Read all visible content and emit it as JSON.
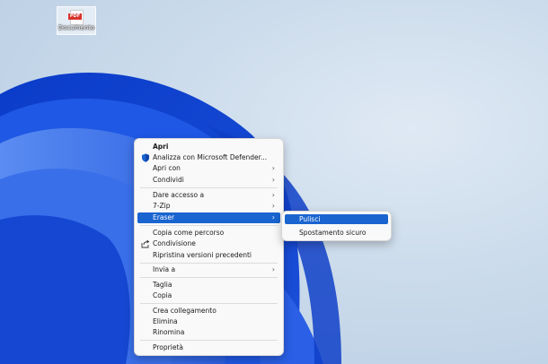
{
  "desktop": {
    "icon": {
      "badge": "PDF",
      "label": "Documento",
      "icon_name": "pdf-file-icon"
    }
  },
  "context_menu": {
    "items": [
      {
        "label": "Apri",
        "bold": true,
        "has_submenu": false,
        "icon": null
      },
      {
        "label": "Analizza con Microsoft Defender...",
        "has_submenu": false,
        "icon": "defender-shield-icon"
      },
      {
        "label": "Apri con",
        "has_submenu": true,
        "icon": null
      },
      {
        "label": "Condividi",
        "has_submenu": true,
        "icon": null
      },
      {
        "label": "Dare accesso a",
        "has_submenu": true,
        "icon": null
      },
      {
        "label": "7-Zip",
        "has_submenu": true,
        "icon": null
      },
      {
        "label": "Eraser",
        "has_submenu": true,
        "icon": null,
        "highlighted": true
      },
      {
        "label": "Copia come percorso",
        "has_submenu": false,
        "icon": null
      },
      {
        "label": "Condivisione",
        "has_submenu": false,
        "icon": "share-icon"
      },
      {
        "label": "Ripristina versioni precedenti",
        "has_submenu": false,
        "icon": null
      },
      {
        "label": "Invia a",
        "has_submenu": true,
        "icon": null
      },
      {
        "label": "Taglia",
        "has_submenu": false,
        "icon": null
      },
      {
        "label": "Copia",
        "has_submenu": false,
        "icon": null
      },
      {
        "label": "Crea collegamento",
        "has_submenu": false,
        "icon": null
      },
      {
        "label": "Elimina",
        "has_submenu": false,
        "icon": null
      },
      {
        "label": "Rinomina",
        "has_submenu": false,
        "icon": null
      },
      {
        "label": "Proprietà",
        "has_submenu": false,
        "icon": null
      }
    ]
  },
  "submenu": {
    "parent": "Eraser",
    "items": [
      {
        "label": "Pulisci",
        "highlighted": true
      },
      {
        "label": "Spostamento sicuro",
        "highlighted": false
      }
    ]
  },
  "colors": {
    "highlight": "#1a64d0",
    "wallpaper_blue": "#1b4fd8",
    "background": "#c9d9ea"
  }
}
